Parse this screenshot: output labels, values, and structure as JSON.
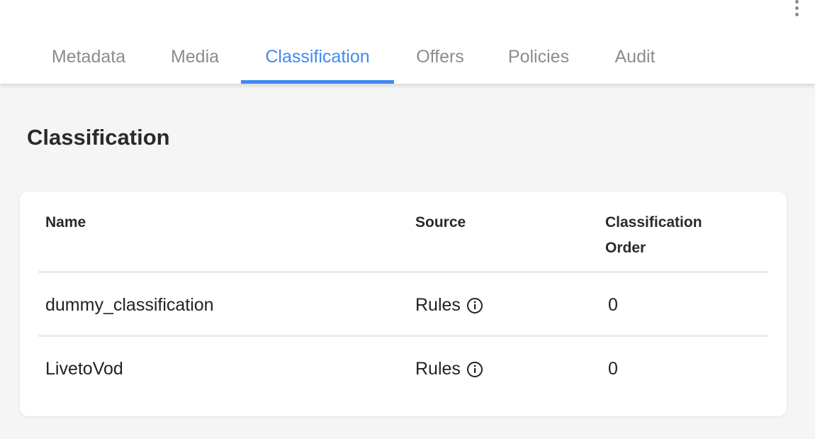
{
  "header": {
    "tabs": [
      {
        "label": "Metadata",
        "active": false
      },
      {
        "label": "Media",
        "active": false
      },
      {
        "label": "Classification",
        "active": true
      },
      {
        "label": "Offers",
        "active": false
      },
      {
        "label": "Policies",
        "active": false
      },
      {
        "label": "Audit",
        "active": false
      }
    ],
    "menu_icon": "more-vert-icon"
  },
  "page": {
    "title": "Classification"
  },
  "table": {
    "columns": [
      "Name",
      "Source",
      "Classification Order"
    ],
    "rows": [
      {
        "name": "dummy_classification",
        "source": "Rules",
        "order": "0"
      },
      {
        "name": "LivetoVod",
        "source": "Rules",
        "order": "0"
      }
    ],
    "source_icon": "info-icon"
  },
  "colors": {
    "accent": "#3f88f5",
    "inactive_tab": "#8c8c8c",
    "background": "#f5f5f5"
  }
}
